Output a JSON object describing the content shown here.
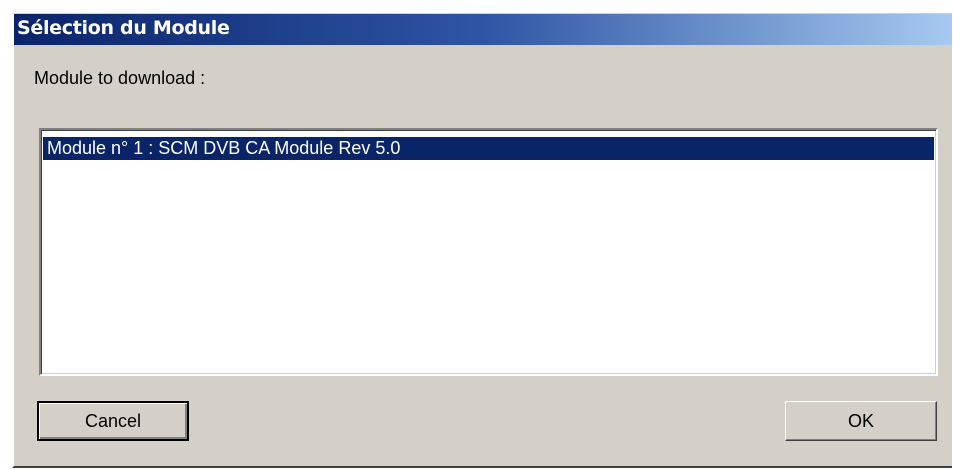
{
  "window": {
    "title": "Sélection du Module"
  },
  "main": {
    "prompt_label": "Module to download :",
    "modules": [
      {
        "label": "Module n° 1 : SCM DVB CA Module Rev 5.0",
        "selected": true
      }
    ]
  },
  "buttons": {
    "cancel_label": "Cancel",
    "ok_label": "OK"
  },
  "colors": {
    "dialog_bg": "#d4d0c8",
    "titlebar_start": "#0a246a",
    "titlebar_end": "#a6caf0",
    "selection_bg": "#0a246a",
    "selection_text": "#ffffff"
  }
}
